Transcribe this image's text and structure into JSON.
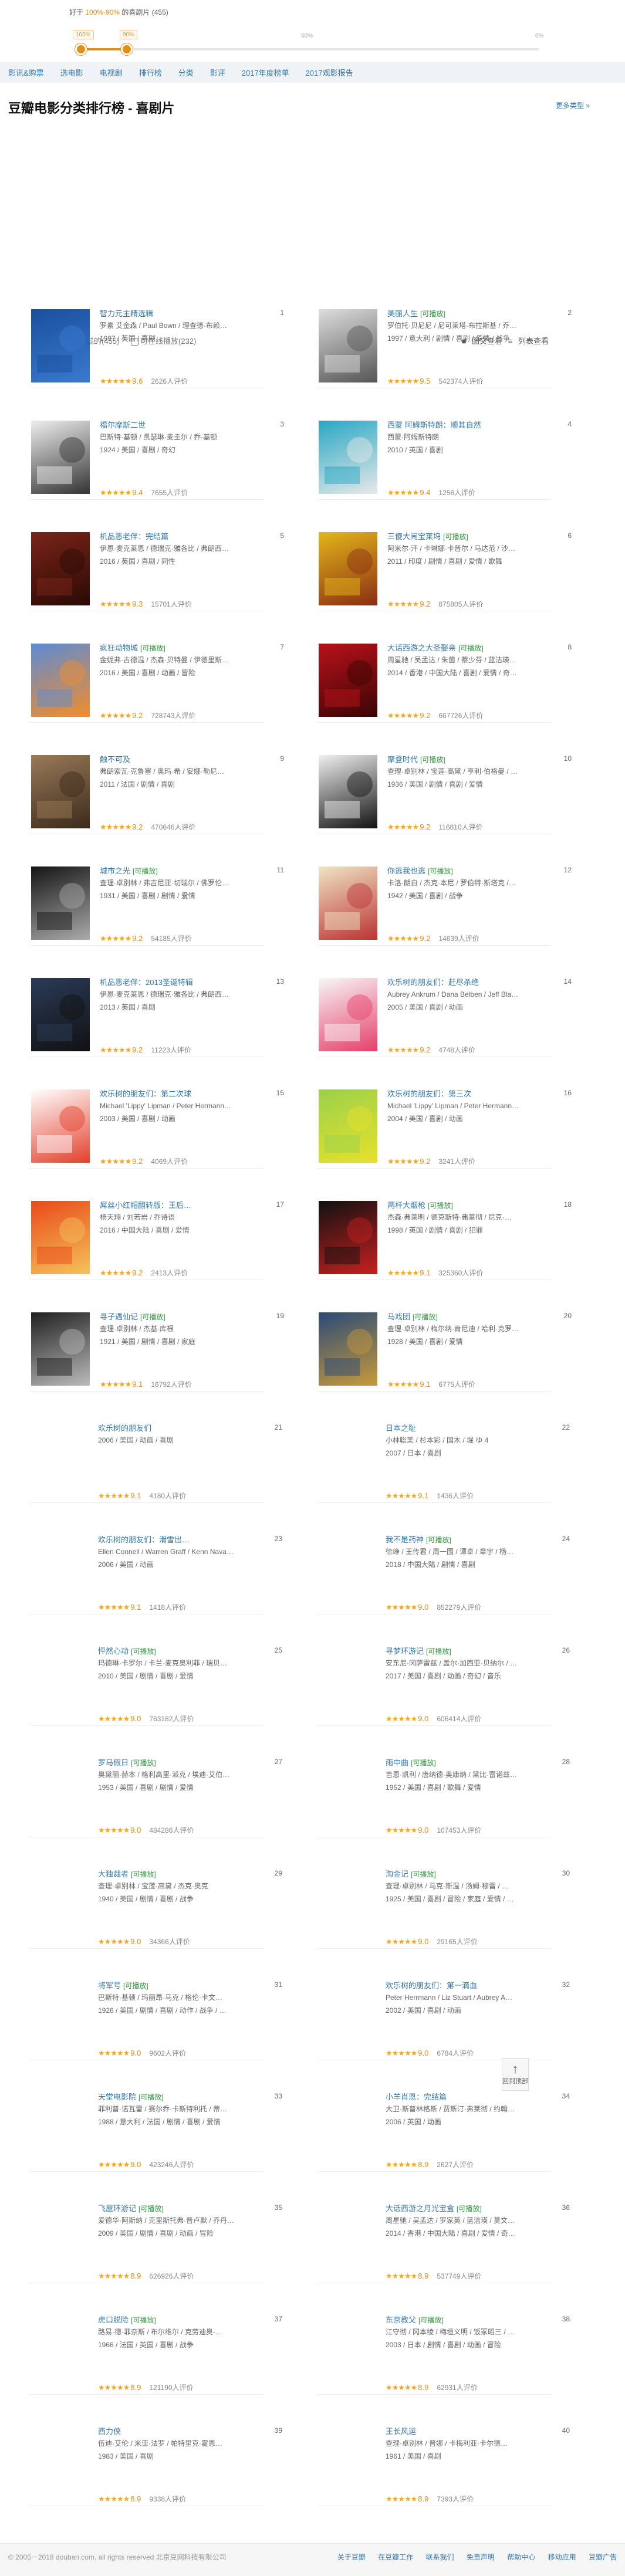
{
  "slider": {
    "tip_prefix": "好于",
    "tip_range": "100%-90%",
    "tip_suffix": "的喜剧片 (455)",
    "knob_left_label": "100%",
    "knob_right_label": "90%",
    "marks": [
      "50%",
      "0%"
    ],
    "selected_from": 1.0,
    "selected_to": 0.9
  },
  "nav": [
    "影讯&购票",
    "选电影",
    "电视剧",
    "排行榜",
    "分类",
    "影评",
    "2017年度榜单",
    "2017观影报告"
  ],
  "header": {
    "title": "豆瓣电影分类排行榜 - 喜剧片",
    "more_types": "更多类型 »"
  },
  "filter": {
    "watched": "我没看过的(455)",
    "playable": "可在线播放(232)",
    "view_image": "图文查看",
    "view_list": "列表查看"
  },
  "movies": [
    {
      "rank": "1",
      "title": "智力元主精选辑",
      "tag": "",
      "cast": "罗素 艾金森 / Paul Bown / 理查德·布赖…",
      "info": "1997 / 英国 / 喜剧",
      "score": "9.6",
      "votes": "2626人评价",
      "stars": 5,
      "poster": [
        "#1a4f9c",
        "#3a7ad0",
        "SKETCH"
      ]
    },
    {
      "rank": "2",
      "title": "美丽人生",
      "tag": "[可播放]",
      "cast": "罗伯托·贝尼尼 / 尼可莱塔·布拉斯基 / 乔…",
      "info": "1997 / 意大利 / 剧情 / 喜剧 / 爱情 / 战争",
      "score": "9.5",
      "votes": "542374人评价",
      "stars": 5,
      "poster": [
        "#ddd",
        "#555",
        ""
      ]
    },
    {
      "rank": "3",
      "title": "福尔摩斯二世",
      "tag": "",
      "cast": "巴斯特·基顿 / 凯瑟琳·麦圭尔 / 乔·基顿",
      "info": "1924 / 美国 / 喜剧 / 奇幻",
      "score": "9.4",
      "votes": "7655人评价",
      "stars": 5,
      "poster": [
        "#eee",
        "#333",
        "BUSTER KEATON\nSHERLOCK Jr."
      ]
    },
    {
      "rank": "4",
      "title": "西蒙 阿姆斯特朗：顺其自然",
      "tag": "",
      "cast": "西蒙·阿姆斯特朗",
      "info": "2010 / 英国 / 喜剧",
      "score": "9.4",
      "votes": "1256人评价",
      "stars": 5,
      "poster": [
        "#28a8c4",
        "#e8e8e8",
        "simon amstell"
      ]
    },
    {
      "rank": "5",
      "title": "机品恶老伴：完结篇",
      "tag": "",
      "cast": "伊恩·麦克莱恩 / 德瑞克·雅各比 / 弗朗西…",
      "info": "2016 / 英国 / 喜剧 / 同性",
      "score": "9.3",
      "votes": "15701人评价",
      "stars": 5,
      "poster": [
        "#7a2418",
        "#2a0a05",
        "VICIOUS"
      ]
    },
    {
      "rank": "6",
      "title": "三傻大闹宝莱坞",
      "tag": "[可播放]",
      "cast": "阿米尔·汗 / 卡琳娜·卡普尔 / 马达范 / 沙…",
      "info": "2011 / 印度 / 剧情 / 喜剧 / 爱情 / 歌舞",
      "score": "9.2",
      "votes": "875805人评价",
      "stars": 5,
      "poster": [
        "#e3b61a",
        "#8a2e13",
        "3 idiots"
      ]
    },
    {
      "rank": "7",
      "title": "疯狂动物城",
      "tag": "[可播放]",
      "cast": "金妮弗·古德温 / 杰森·贝特曼 / 伊德里斯…",
      "info": "2016 / 美国 / 喜剧 / 动画 / 冒险",
      "score": "9.2",
      "votes": "728743人评价",
      "stars": 5,
      "poster": [
        "#5a8bd6",
        "#f28d2b",
        "ZOOTOPIA"
      ]
    },
    {
      "rank": "8",
      "title": "大话西游之大圣娶亲",
      "tag": "[可播放]",
      "cast": "周星驰 / 吴孟达 / 朱茵 / 蔡少芬 / 蓝洁瑛…",
      "info": "2014 / 香港 / 中国大陆 / 喜剧 / 爱情 / 奇…",
      "score": "9.2",
      "votes": "667726人评价",
      "stars": 5,
      "poster": [
        "#b8121a",
        "#3a0505",
        "大话西游"
      ]
    },
    {
      "rank": "9",
      "title": "触不可及",
      "tag": "",
      "cast": "弗朗索瓦·克鲁塞 / 奥玛·希 / 安娜·勒尼…",
      "info": "2011 / 法国 / 剧情 / 喜剧",
      "score": "9.2",
      "votes": "470646人评价",
      "stars": 5,
      "poster": [
        "#9a7a58",
        "#3b2a1c",
        ""
      ]
    },
    {
      "rank": "10",
      "title": "摩登时代",
      "tag": "[可播放]",
      "cast": "查理·卓别林 / 宝莲·高黛 / 亨利·伯格曼 / …",
      "info": "1936 / 美国 / 剧情 / 喜剧 / 爱情",
      "score": "9.2",
      "votes": "116810人评价",
      "stars": 5,
      "poster": [
        "#f0f0f0",
        "#111",
        ""
      ]
    },
    {
      "rank": "11",
      "title": "城市之光",
      "tag": "[可播放]",
      "cast": "查理·卓别林 / 弗吉尼亚·切瑞尔 / 佛罗伦…",
      "info": "1931 / 美国 / 喜剧 / 剧情 / 爱情",
      "score": "9.2",
      "votes": "54185人评价",
      "stars": 5,
      "poster": [
        "#151515",
        "#aaa",
        "CITY LIGHTS"
      ]
    },
    {
      "rank": "12",
      "title": "你逃我也逃",
      "tag": "[可播放]",
      "cast": "卡洛·朗白 / 杰克·本尼 / 罗伯特·斯塔克 /…",
      "info": "1942 / 美国 / 喜剧 / 战争",
      "score": "9.2",
      "votes": "14639人评价",
      "stars": 5,
      "poster": [
        "#f0e4c4",
        "#b33",
        ""
      ]
    },
    {
      "rank": "13",
      "title": "机品恶老伴：2013圣诞特辑",
      "tag": "",
      "cast": "伊恩·麦克莱恩 / 德瑞克·雅各比 / 弗朗西…",
      "info": "2013 / 英国 / 喜剧",
      "score": "9.2",
      "votes": "11223人评价",
      "stars": 5,
      "poster": [
        "#2a3b58",
        "#111",
        "VICIOUS"
      ]
    },
    {
      "rank": "14",
      "title": "欢乐树的朋友们：赶尽杀绝",
      "tag": "",
      "cast": "Aubrey Ankrum / Dana Belben / Jeff Bla…",
      "info": "2005 / 美国 / 喜剧 / 动画",
      "score": "9.2",
      "votes": "4748人评价",
      "stars": 5,
      "poster": [
        "#f7f7f7",
        "#e63f6a",
        ""
      ]
    },
    {
      "rank": "15",
      "title": "欢乐树的朋友们：第二次球",
      "tag": "",
      "cast": "Michael 'Lippy' Lipman / Peter Hermann…",
      "info": "2003 / 美国 / 喜剧 / 动画",
      "score": "9.2",
      "votes": "4069人评价",
      "stars": 5,
      "poster": [
        "#fff",
        "#e3402c",
        "We're Scroggled"
      ]
    },
    {
      "rank": "16",
      "title": "欢乐树的朋友们：第三次",
      "tag": "",
      "cast": "Michael 'Lippy' Lipman / Peter Hermann…",
      "info": "2004 / 美国 / 喜剧 / 动画",
      "score": "9.2",
      "votes": "3241人评价",
      "stars": 5,
      "poster": [
        "#9bd14b",
        "#e6e12a",
        "Blurb"
      ]
    },
    {
      "rank": "17",
      "title": "屌丝小红帽翻转版：王后…",
      "tag": "",
      "cast": "杨天翔 / 刘若岩 / 乔诗语",
      "info": "2016 / 中国大陆 / 喜剧 / 爱情",
      "score": "9.2",
      "votes": "2413人评价",
      "stars": 5,
      "poster": [
        "#e84a1a",
        "#f5c25a",
        ""
      ]
    },
    {
      "rank": "18",
      "title": "两杆大烟枪",
      "tag": "[可播放]",
      "cast": "杰森·弗莱明 / 德克斯特·弗莱彻 / 尼克·…",
      "info": "1998 / 英国 / 剧情 / 喜剧 / 犯罪",
      "score": "9.1",
      "votes": "325360人评价",
      "stars": 5,
      "poster": [
        "#111",
        "#c82020",
        "LOCK STOCK"
      ]
    },
    {
      "rank": "19",
      "title": "寻子遇仙记",
      "tag": "[可播放]",
      "cast": "查理·卓别林 / 杰基·库根",
      "info": "1921 / 美国 / 剧情 / 喜剧 / 家庭",
      "score": "9.1",
      "votes": "16792人评价",
      "stars": 5,
      "poster": [
        "#202020",
        "#bbb",
        "THE KID"
      ]
    },
    {
      "rank": "20",
      "title": "马戏团",
      "tag": "[可播放]",
      "cast": "查理·卓别林 / 梅尔纳·肯尼迪 / 哈利·克罗…",
      "info": "1928 / 美国 / 喜剧 / 爱情",
      "score": "9.1",
      "votes": "6775人评价",
      "stars": 5,
      "poster": [
        "#2a4a78",
        "#c89a3a",
        "CIRCUS"
      ]
    },
    {
      "rank": "21",
      "title": "欢乐树的朋友们",
      "tag": "",
      "cast": "",
      "info": "2006 / 美国 / 动画 / 喜剧",
      "score": "9.1",
      "votes": "4180人评价",
      "stars": 5,
      "poster": null
    },
    {
      "rank": "22",
      "title": "日本之耻",
      "tag": "",
      "cast": "小林聡美 / 杉本彩 / 国木 / 堀 ゆ 4",
      "info": "2007 / 日本 / 喜剧",
      "score": "9.1",
      "votes": "1436人评价",
      "stars": 5,
      "poster": null
    },
    {
      "rank": "23",
      "title": "欢乐树的朋友们：滑雪出…",
      "tag": "",
      "cast": "Ellen Connell / Warren Graff / Kenn Nava…",
      "info": "2006 / 美国 / 动画",
      "score": "9.1",
      "votes": "1418人评价",
      "stars": 5,
      "poster": null
    },
    {
      "rank": "24",
      "title": "我不是药神",
      "tag": "[可播放]",
      "cast": "徐峥 / 王传君 / 周一围 / 谭卓 / 章宇 / 杨…",
      "info": "2018 / 中国大陆 / 剧情 / 喜剧",
      "score": "9.0",
      "votes": "852279人评价",
      "stars": 5,
      "poster": null
    },
    {
      "rank": "25",
      "title": "怦然心动",
      "tag": "[可播放]",
      "cast": "玛德琳·卡罗尔 / 卡兰·麦克奥利菲 / 瑞贝…",
      "info": "2010 / 美国 / 剧情 / 喜剧 / 爱情",
      "score": "9.0",
      "votes": "763182人评价",
      "stars": 5,
      "poster": null
    },
    {
      "rank": "26",
      "title": "寻梦环游记",
      "tag": "[可播放]",
      "cast": "安东尼·冈萨雷兹 / 盖尔·加西亚·贝纳尔 / …",
      "info": "2017 / 美国 / 喜剧 / 动画 / 奇幻 / 音乐",
      "score": "9.0",
      "votes": "606414人评价",
      "stars": 5,
      "poster": null
    },
    {
      "rank": "27",
      "title": "罗马假日",
      "tag": "[可播放]",
      "cast": "奥黛丽·赫本 / 格利高里·派克 / 埃迪·艾伯…",
      "info": "1953 / 美国 / 喜剧 / 剧情 / 爱情",
      "score": "9.0",
      "votes": "484286人评价",
      "stars": 5,
      "poster": null
    },
    {
      "rank": "28",
      "title": "雨中曲",
      "tag": "[可播放]",
      "cast": "吉恩·凯利 / 唐纳德·奥康纳 / 黛比·雷诺兹…",
      "info": "1952 / 美国 / 喜剧 / 歌舞 / 爱情",
      "score": "9.0",
      "votes": "107453人评价",
      "stars": 5,
      "poster": null
    },
    {
      "rank": "29",
      "title": "大独裁者",
      "tag": "[可播放]",
      "cast": "查理·卓别林 / 宝莲·高黛 / 杰克·奥克",
      "info": "1940 / 美国 / 剧情 / 喜剧 / 战争",
      "score": "9.0",
      "votes": "34366人评价",
      "stars": 5,
      "poster": null
    },
    {
      "rank": "30",
      "title": "淘金记",
      "tag": "[可播放]",
      "cast": "查理·卓别林 / 马克·斯温 / 汤姆·穆雷 / …",
      "info": "1925 / 美国 / 喜剧 / 冒险 / 家庭 / 爱情 / …",
      "score": "9.0",
      "votes": "29165人评价",
      "stars": 5,
      "poster": null
    },
    {
      "rank": "31",
      "title": "将军号",
      "tag": "[可播放]",
      "cast": "巴斯特·基顿 / 玛丽昂·马克 / 格伦·卡文…",
      "info": "1926 / 美国 / 剧情 / 喜剧 / 动作 / 战争 / …",
      "score": "9.0",
      "votes": "9602人评价",
      "stars": 5,
      "poster": null
    },
    {
      "rank": "32",
      "title": "欢乐树的朋友们：第一滴血",
      "tag": "",
      "cast": "Peter Herrmann / Liz Stuart / Aubrey A…",
      "info": "2002 / 美国 / 喜剧 / 动画",
      "score": "9.0",
      "votes": "6784人评价",
      "stars": 5,
      "poster": null
    },
    {
      "rank": "33",
      "title": "天堂电影院",
      "tag": "[可播放]",
      "cast": "菲利普·诺瓦雷 / 赛尔乔·卡斯特利托 / 蒂…",
      "info": "1988 / 意大利 / 法国 / 剧情 / 喜剧 / 爱情",
      "score": "9.0",
      "votes": "423246人评价",
      "stars": 5,
      "poster": null
    },
    {
      "rank": "34",
      "title": "小羊肖恩：完结篇",
      "tag": "",
      "cast": "大卫·斯普林格斯 / 贾斯汀·弗莱彻 / 约翰…",
      "info": "2006 / 英国 / 动画",
      "score": "8.9",
      "votes": "2627人评价",
      "stars": 5,
      "poster": null
    },
    {
      "rank": "35",
      "title": "飞屋环游记",
      "tag": "[可播放]",
      "cast": "爱德华·阿斯纳 / 克里斯托弗·普卢默 / 乔丹…",
      "info": "2009 / 美国 / 剧情 / 喜剧 / 动画 / 冒险",
      "score": "8.9",
      "votes": "626926人评价",
      "stars": 5,
      "poster": null
    },
    {
      "rank": "36",
      "title": "大话西游之月光宝盒",
      "tag": "[可播放]",
      "cast": "周星驰 / 吴孟达 / 罗家英 / 蓝洁瑛 / 莫文…",
      "info": "2014 / 香港 / 中国大陆 / 喜剧 / 爱情 / 奇…",
      "score": "8.9",
      "votes": "537749人评价",
      "stars": 5,
      "poster": null
    },
    {
      "rank": "37",
      "title": "虎口脱险",
      "tag": "[可播放]",
      "cast": "路易·德·菲奈斯 / 布尔维尔 / 克劳迪奥·…",
      "info": "1966 / 法国 / 英国 / 喜剧 / 战争",
      "score": "8.9",
      "votes": "121190人评价",
      "stars": 5,
      "poster": null
    },
    {
      "rank": "38",
      "title": "东京教父",
      "tag": "[可播放]",
      "cast": "江守彻 / 冈本绫 / 梅垣义明 / 饭冢昭三 / …",
      "info": "2003 / 日本 / 剧情 / 喜剧 / 动画 / 冒险",
      "score": "8.9",
      "votes": "62931人评价",
      "stars": 5,
      "poster": null
    },
    {
      "rank": "39",
      "title": "西力侠",
      "tag": "",
      "cast": "伍迪·艾伦 / 米亚·法罗 / 帕特里克·霍恩…",
      "info": "1983 / 美国 / 喜剧",
      "score": "8.9",
      "votes": "9338人评价",
      "stars": 5,
      "poster": null
    },
    {
      "rank": "40",
      "title": "王长风运",
      "tag": "",
      "cast": "查理·卓别林 / 普娜 / 卡梅利亚·卡尔德…",
      "info": "1961 / 美国 / 喜剧",
      "score": "8.9",
      "votes": "7393人评价",
      "stars": 5,
      "poster": null
    }
  ],
  "back_to_top": "回到顶部",
  "footer": {
    "copyright": "© 2005－2018 douban.com, all rights reserved 北京豆网科技有限公司",
    "links": [
      "关于豆瓣",
      "在豆瓣工作",
      "联系我们",
      "免责声明",
      "帮助中心",
      "移动应用",
      "豆瓣广告"
    ]
  }
}
